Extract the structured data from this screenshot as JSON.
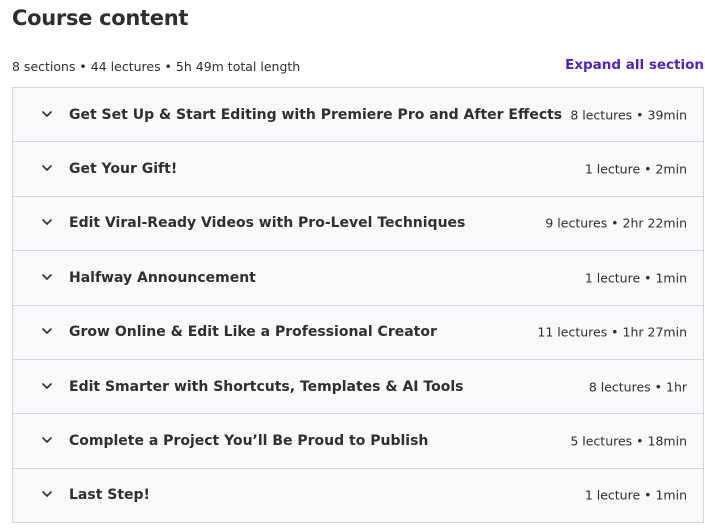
{
  "header": {
    "title": "Course content",
    "summary": "8 sections • 44 lectures • 5h 49m total length",
    "expand_label": "Expand all section"
  },
  "sections": [
    {
      "title": "Get Set Up & Start Editing with Premiere Pro and After Effects",
      "meta": "8 lectures • 39min"
    },
    {
      "title": "Get Your Gift!",
      "meta": "1 lecture • 2min"
    },
    {
      "title": "Edit Viral-Ready Videos with Pro-Level Techniques",
      "meta": "9 lectures • 2hr 22min"
    },
    {
      "title": "Halfway Announcement",
      "meta": "1 lecture • 1min"
    },
    {
      "title": "Grow Online & Edit Like a Professional Creator",
      "meta": "11 lectures • 1hr 27min"
    },
    {
      "title": "Edit Smarter with Shortcuts, Templates & AI Tools",
      "meta": "8 lectures • 1hr"
    },
    {
      "title": "Complete a Project You’ll Be Proud to Publish",
      "meta": "5 lectures • 18min"
    },
    {
      "title": "Last Step!",
      "meta": "1 lecture • 1min"
    }
  ],
  "icons": {
    "section_toggle": "chevron-down-icon"
  },
  "colors": {
    "accent": "#5022c3",
    "text": "#2d2f31",
    "section_bg": "#f7f9fa",
    "border": "#d1d7dc"
  }
}
